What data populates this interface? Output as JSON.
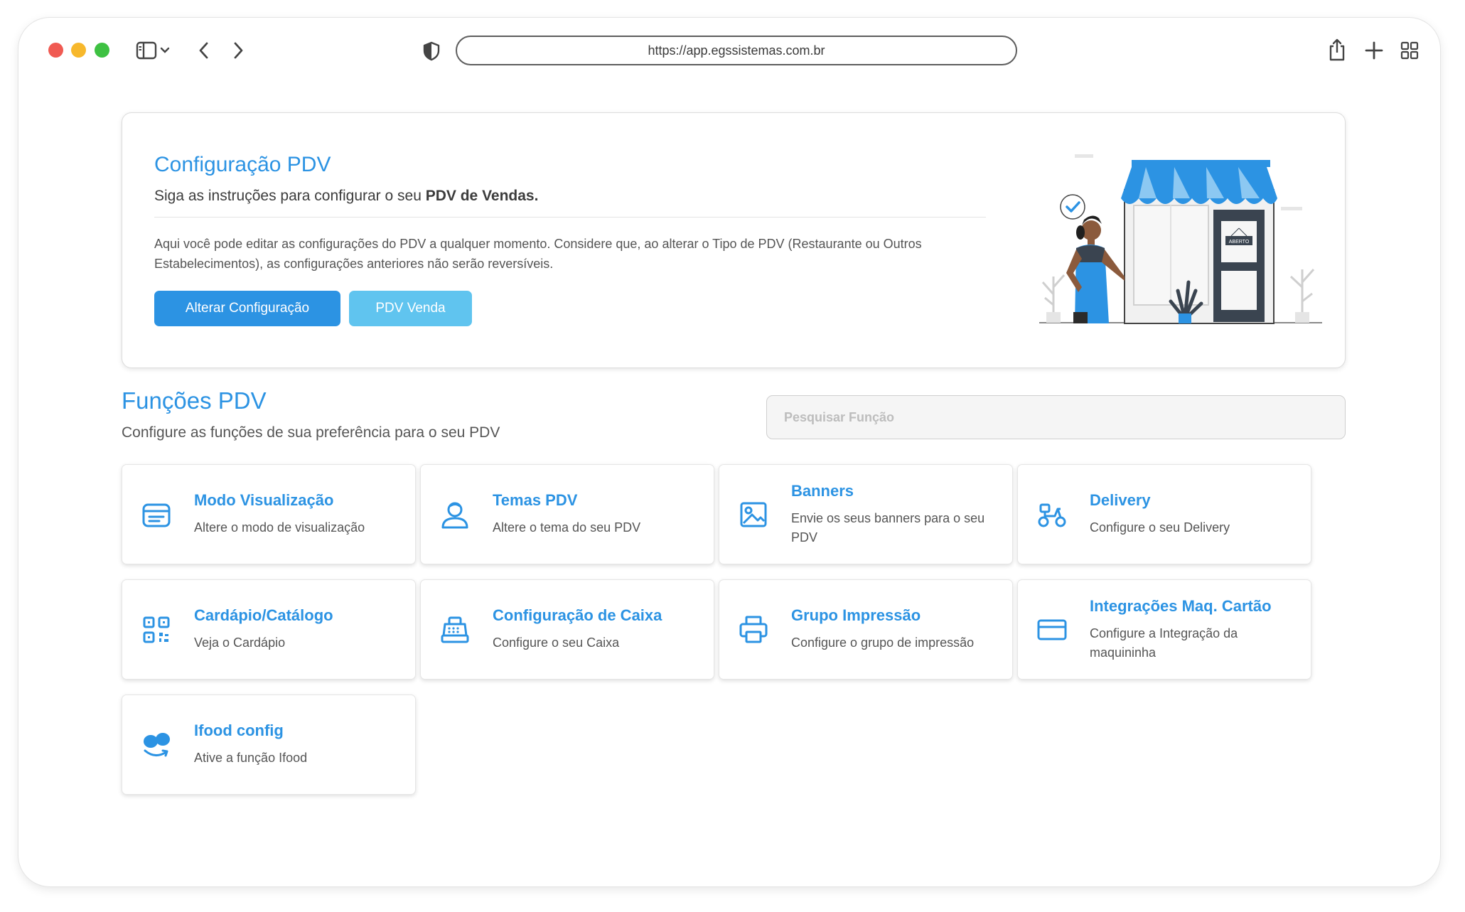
{
  "browser": {
    "url": "https://app.egssistemas.com.br"
  },
  "hero": {
    "title": "Configuração PDV",
    "subtitle_prefix": "Siga as instruções para configurar o seu ",
    "subtitle_bold": "PDV de Vendas.",
    "description": "Aqui você pode editar as configurações do PDV a qualquer momento. Considere que, ao alterar o Tipo de PDV (Restaurante ou Outros Estabelecimentos), as configurações anteriores não serão reversíveis.",
    "primary_button": "Alterar Configuração",
    "secondary_button": "PDV Venda",
    "illustration_sign": "ABERTO"
  },
  "functions": {
    "title": "Funções PDV",
    "subtitle": "Configure as funções de sua preferência para o seu PDV",
    "search_placeholder": "Pesquisar Função",
    "cards": [
      {
        "title": "Modo Visualização",
        "description": "Altere o modo de visualização",
        "icon": "view-mode-icon"
      },
      {
        "title": "Temas PDV",
        "description": "Altere o tema do seu PDV",
        "icon": "user-theme-icon"
      },
      {
        "title": "Banners",
        "description": "Envie os seus banners para o seu PDV",
        "icon": "image-icon"
      },
      {
        "title": "Delivery",
        "description": "Configure o seu Delivery",
        "icon": "scooter-icon"
      },
      {
        "title": "Cardápio/Catálogo",
        "description": "Veja o Cardápio",
        "icon": "qr-code-icon"
      },
      {
        "title": "Configuração de Caixa",
        "description": "Configure o seu Caixa",
        "icon": "cash-register-icon"
      },
      {
        "title": "Grupo Impressão",
        "description": "Configure o grupo de impressão",
        "icon": "printer-icon"
      },
      {
        "title": "Integrações Maq. Cartão",
        "description": "Configure a Integração da maquininha",
        "icon": "credit-card-icon"
      },
      {
        "title": "Ifood config",
        "description": "Ative a função Ifood",
        "icon": "ifood-icon"
      }
    ]
  },
  "colors": {
    "accent": "#2c93e3",
    "secondary_button": "#60c4ef"
  }
}
